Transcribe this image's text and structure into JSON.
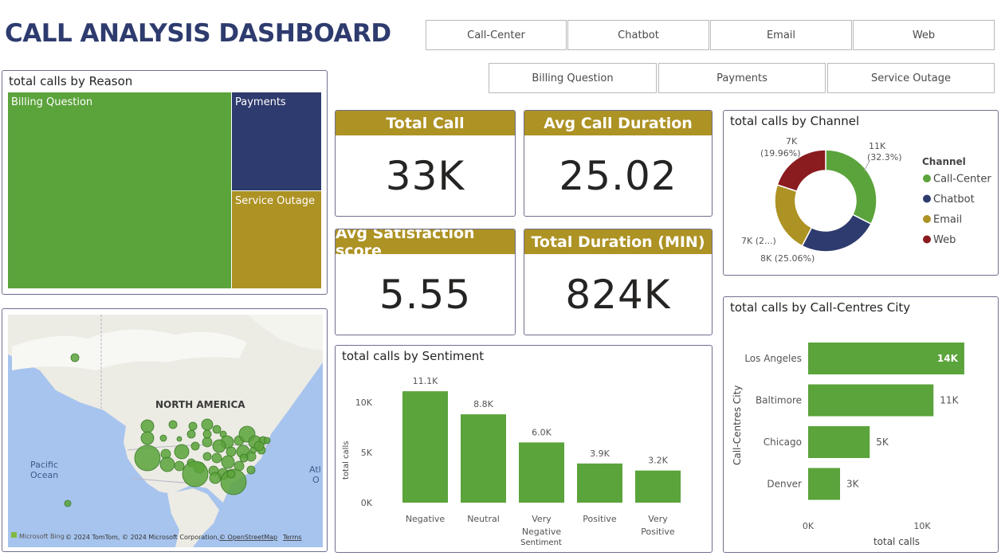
{
  "header": {
    "title": "CALL ANALYSIS DASHBOARD"
  },
  "slicers": {
    "channels": [
      "Call-Center",
      "Chatbot",
      "Email",
      "Web"
    ],
    "reasons": [
      "Billing Question",
      "Payments",
      "Service Outage"
    ]
  },
  "kpis": [
    {
      "label": "Total Call",
      "value": "33K"
    },
    {
      "label": "Avg Call Duration",
      "value": "25.02"
    },
    {
      "label": "Avg Satisfaction score",
      "value": "5.55"
    },
    {
      "label": "Total Duration (MIN)",
      "value": "824K"
    }
  ],
  "treemap": {
    "title": "total calls by Reason",
    "items": [
      {
        "label": "Billing Question",
        "color": "#5ba33b"
      },
      {
        "label": "Payments",
        "color": "#2e3b6e"
      },
      {
        "label": "Service Outage",
        "color": "#ad9224"
      }
    ]
  },
  "map": {
    "label_continent": "NORTH AMERICA",
    "label_ocean_1": "Pacific",
    "label_ocean_2": "Ocean",
    "label_atl_1": "Atl",
    "label_atl_2": "O",
    "bing": "Microsoft Bing",
    "attribution": "© 2024 TomTom, © 2024 Microsoft Corporation,",
    "osm": "© OpenStreetMap",
    "terms": "Terms",
    "bubble_color": "#5ba33b"
  },
  "chart_data": [
    {
      "type": "pie",
      "title": "total calls by Channel",
      "legend_title": "Channel",
      "categories": [
        "Call-Center",
        "Chatbot",
        "Email",
        "Web"
      ],
      "values": [
        10.6,
        8.2,
        7.3,
        6.5
      ],
      "percent": [
        32.3,
        25.06,
        22.68,
        19.96
      ],
      "data_labels": [
        "11K",
        "(32.3%)",
        "8K (25.06%)",
        "7K (2...)",
        "7K",
        "(19.96%)"
      ],
      "colors": [
        "#5ba33b",
        "#2e3b6e",
        "#ad9224",
        "#8a1b1f"
      ],
      "legend_position": "right"
    },
    {
      "type": "bar",
      "title": "total calls by Sentiment",
      "xlabel": "Sentiment",
      "ylabel": "total calls",
      "categories": [
        "Negative",
        "Neutral",
        "Very Negative",
        "Positive",
        "Very Positive"
      ],
      "values": [
        11.1,
        8.8,
        6.0,
        3.9,
        3.2
      ],
      "data_labels": [
        "11.1K",
        "8.8K",
        "6.0K",
        "3.9K",
        "3.2K"
      ],
      "y_ticks": [
        "0K",
        "5K",
        "10K"
      ],
      "ylim": [
        0,
        13
      ],
      "color": "#5ba33b"
    },
    {
      "type": "bar",
      "orientation": "horizontal",
      "title": "total calls by Call-Centres City",
      "xlabel": "total calls",
      "ylabel": "Call-Centres City",
      "categories": [
        "Los Angeles",
        "Baltimore",
        "Chicago",
        "Denver"
      ],
      "values": [
        13.7,
        11.0,
        5.4,
        2.8
      ],
      "data_labels": [
        "14K",
        "11K",
        "5K",
        "3K"
      ],
      "x_ticks": [
        "0K",
        "10K"
      ],
      "xlim": [
        0,
        20
      ],
      "color": "#5ba33b"
    }
  ]
}
